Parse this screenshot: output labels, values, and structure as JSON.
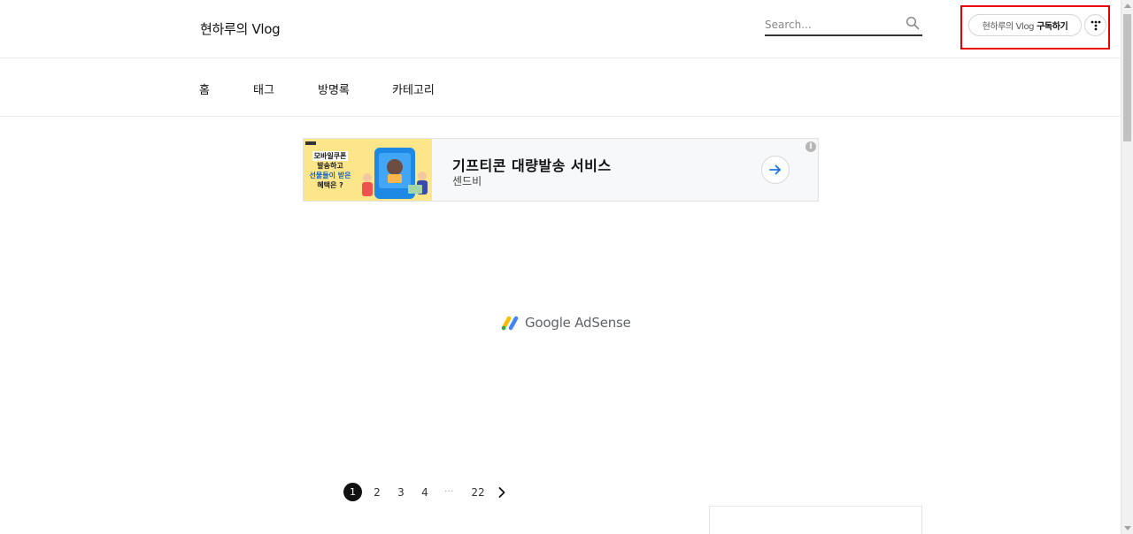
{
  "header": {
    "blog_title": "현하루의 Vlog",
    "search": {
      "placeholder": "Search..."
    },
    "subscribe": {
      "blog_name": "현하루의 Vlog",
      "action": "구독하기"
    }
  },
  "nav": {
    "items": [
      {
        "label": "홈"
      },
      {
        "label": "태그"
      },
      {
        "label": "방명록"
      },
      {
        "label": "카테고리"
      }
    ]
  },
  "ad": {
    "image_lines": [
      "모바일쿠폰",
      "발송하고",
      "선물들이 받은",
      "혜택은 ?"
    ],
    "title": "기프티콘 대량발송 서비스",
    "advertiser": "센드비",
    "info_label": "i"
  },
  "adsense": {
    "label": "Google AdSense"
  },
  "pagination": {
    "pages": [
      "1",
      "2",
      "3",
      "4"
    ],
    "ellipsis": "···",
    "last": "22",
    "current": "1"
  },
  "colors": {
    "highlight": "#e60000",
    "text": "#111111",
    "ad_background": "#f7f8fa",
    "ad_image_background": "#fde58a",
    "arrow_blue": "#1a73e8"
  }
}
